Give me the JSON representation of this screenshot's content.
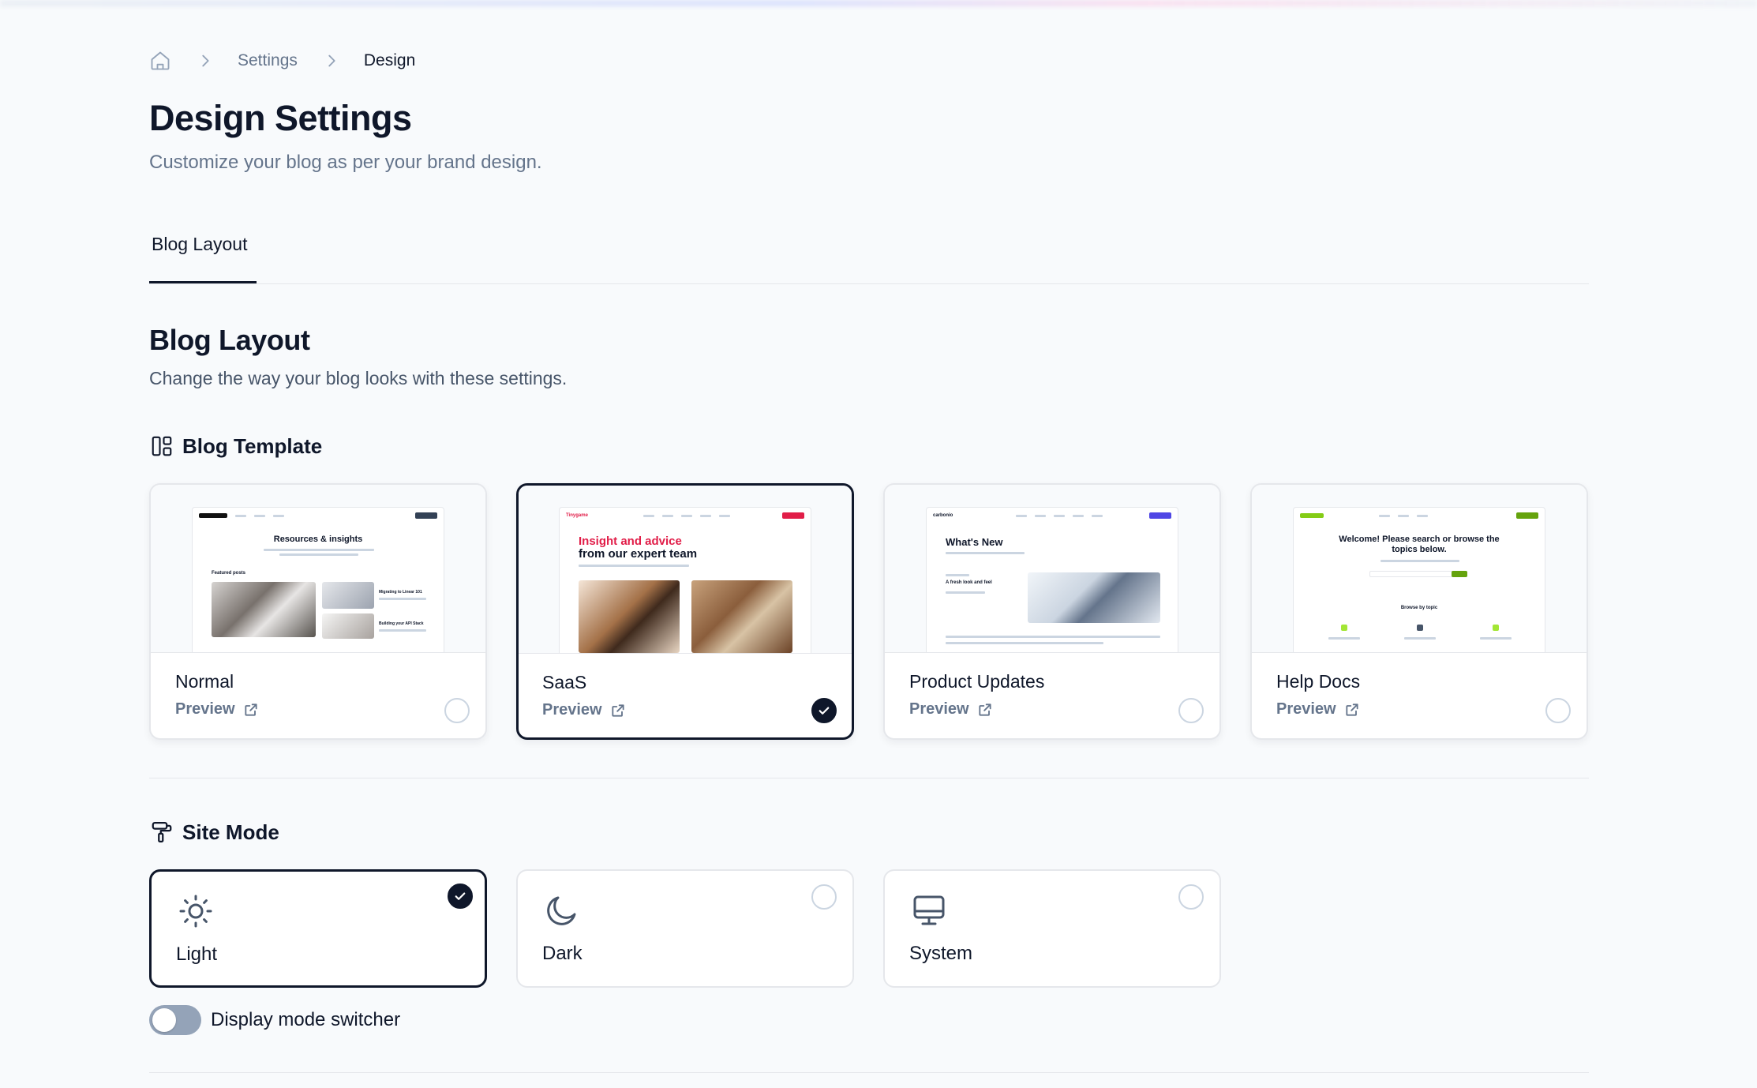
{
  "breadcrumb": {
    "items": [
      "Settings",
      "Design"
    ]
  },
  "page": {
    "title": "Design Settings",
    "subtitle": "Customize your blog as per your brand design."
  },
  "tabs": [
    {
      "label": "Blog Layout",
      "active": true
    }
  ],
  "section": {
    "title": "Blog Layout",
    "description": "Change the way your blog looks with these settings."
  },
  "blog_template": {
    "heading": "Blog Template",
    "preview_label": "Preview",
    "options": [
      {
        "name": "Normal",
        "selected": false,
        "thumb_title": "Resources & insights",
        "thumb_sub": "Featured posts",
        "thumb_post": "Migrating to Linear 101",
        "thumb_post2": "Building your API Stack"
      },
      {
        "name": "SaaS",
        "selected": true,
        "thumb_brand": "Tinygame",
        "thumb_title_accent": "Insight and advice",
        "thumb_title": "from our expert team"
      },
      {
        "name": "Product Updates",
        "selected": false,
        "thumb_brand": "carbonio",
        "thumb_title": "What's New",
        "thumb_post": "A fresh look and feel"
      },
      {
        "name": "Help Docs",
        "selected": false,
        "thumb_title": "Welcome! Please search or browse the topics below.",
        "thumb_sub": "Browse by topic"
      }
    ]
  },
  "site_mode": {
    "heading": "Site Mode",
    "options": [
      {
        "label": "Light",
        "icon": "sun-icon",
        "selected": true
      },
      {
        "label": "Dark",
        "icon": "moon-icon",
        "selected": false
      },
      {
        "label": "System",
        "icon": "monitor-icon",
        "selected": false
      }
    ],
    "switcher_label": "Display mode switcher",
    "switcher_on": false
  },
  "colors": {
    "primary": "#0f172a",
    "muted": "#64748b",
    "border": "#e5e7eb",
    "saas_accent": "#e11d48"
  }
}
